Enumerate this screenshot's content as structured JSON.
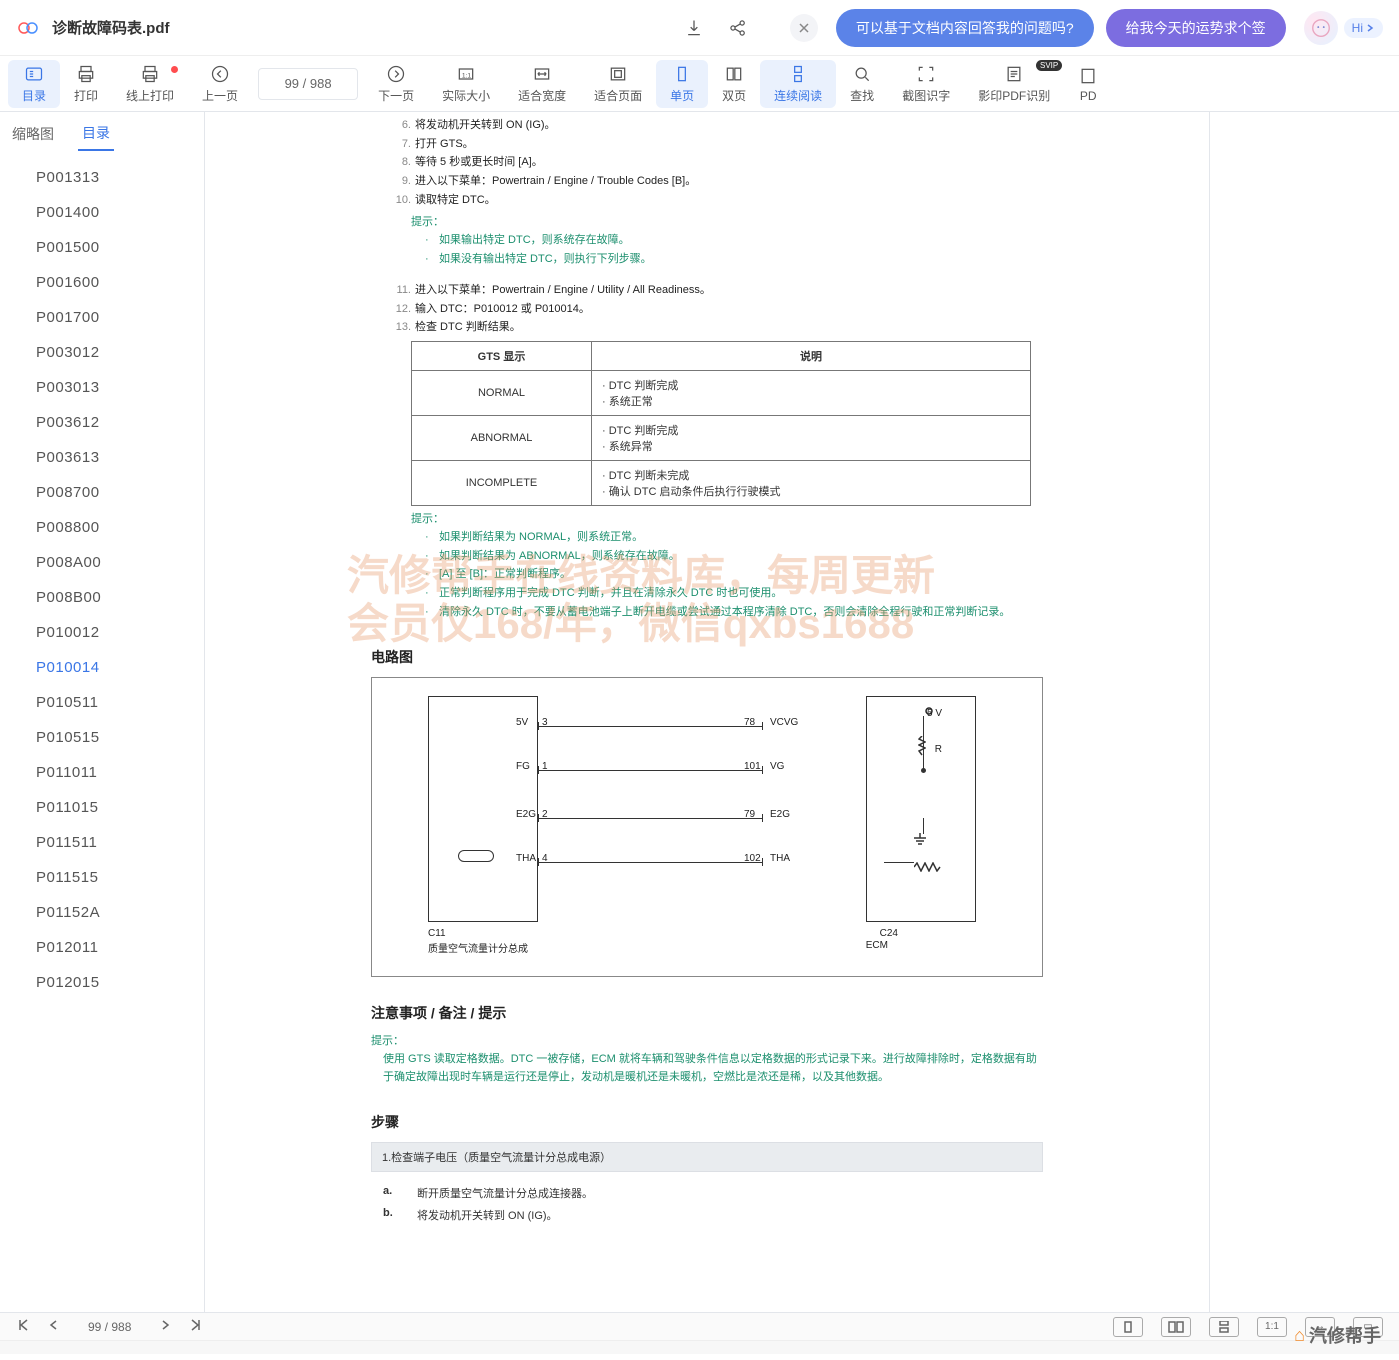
{
  "header": {
    "doc_title": "诊断故障码表.pdf",
    "chip_question": "可以基于文档内容回答我的问题吗?",
    "chip_fortune": "给我今天的运势求个签",
    "hi": "Hi",
    "download_icon": "download-icon",
    "share_icon": "share-icon",
    "close_icon": "close-icon"
  },
  "toolbar": {
    "items": [
      {
        "key": "toc",
        "label": "目录",
        "active": true
      },
      {
        "key": "print",
        "label": "打印"
      },
      {
        "key": "online_print",
        "label": "线上打印",
        "dot": true
      },
      {
        "key": "prev",
        "label": "上一页"
      },
      {
        "key": "page_ind",
        "page_text": "99 / 988",
        "is_indicator": true
      },
      {
        "key": "next",
        "label": "下一页"
      },
      {
        "key": "actual_size",
        "label": "实际大小"
      },
      {
        "key": "fit_width",
        "label": "适合宽度"
      },
      {
        "key": "fit_page",
        "label": "适合页面"
      },
      {
        "key": "single",
        "label": "单页",
        "active": true
      },
      {
        "key": "double",
        "label": "双页"
      },
      {
        "key": "continuous",
        "label": "连续阅读",
        "active": true
      },
      {
        "key": "find",
        "label": "查找"
      },
      {
        "key": "crop_ocr",
        "label": "截图识字"
      },
      {
        "key": "scan_pdf",
        "label": "影印PDF识别",
        "svip": "SVIP"
      },
      {
        "key": "pdf_trunc",
        "label": "PD"
      }
    ]
  },
  "side": {
    "tabs": [
      "缩略图",
      "目录"
    ],
    "active_tab": "目录",
    "toc": [
      "P001313",
      "P001400",
      "P001500",
      "P001600",
      "P001700",
      "P003012",
      "P003013",
      "P003612",
      "P003613",
      "P008700",
      "P008800",
      "P008A00",
      "P008B00",
      "P010012",
      "P010014",
      "P010511",
      "P010515",
      "P011011",
      "P011015",
      "P011511",
      "P011515",
      "P01152A",
      "P012011",
      "P012015"
    ],
    "active_toc": "P010014"
  },
  "doc": {
    "steps_a": [
      {
        "n": "6.",
        "t": "将发动机开关转到 ON (IG)。"
      },
      {
        "n": "7.",
        "t": "打开 GTS。"
      },
      {
        "n": "8.",
        "t": "等待 5 秒或更长时间 [A]。"
      },
      {
        "n": "9.",
        "t": "进入以下菜单：Powertrain / Engine / Trouble Codes [B]。"
      },
      {
        "n": "10.",
        "t": "读取特定 DTC。"
      }
    ],
    "hint1_title": "提示：",
    "hint1_items": [
      "如果输出特定 DTC，则系统存在故障。",
      "如果没有输出特定 DTC，则执行下列步骤。"
    ],
    "steps_b": [
      {
        "n": "11.",
        "t": "进入以下菜单：Powertrain / Engine / Utility / All Readiness。"
      },
      {
        "n": "12.",
        "t": "输入 DTC：P010012 或 P010014。"
      },
      {
        "n": "13.",
        "t": "检查 DTC 判断结果。"
      }
    ],
    "table": {
      "head": [
        "GTS 显示",
        "说明"
      ],
      "rows": [
        {
          "c1": "NORMAL",
          "c2": [
            "DTC 判断完成",
            "系统正常"
          ]
        },
        {
          "c1": "ABNORMAL",
          "c2": [
            "DTC 判断完成",
            "系统异常"
          ]
        },
        {
          "c1": "INCOMPLETE",
          "c2": [
            "DTC 判断未完成",
            "确认 DTC 启动条件后执行行驶模式"
          ]
        }
      ]
    },
    "hint2_title": "提示：",
    "hint2_items": [
      "如果判断结果为 NORMAL，则系统正常。",
      "如果判断结果为 ABNORMAL，则系统存在故障。",
      "[A] 至 [B]：正常判断程序。",
      "正常判断程序用于完成 DTC 判断，并且在清除永久 DTC 时也可使用。",
      "清除永久 DTC 时，不要从蓄电池端子上断开电缆或尝试通过本程序清除 DTC，否则会清除全程行驶和正常判断记录。"
    ],
    "circuit_title": "电路图",
    "circuit": {
      "left_label": "C11",
      "left_sub": "质量空气流量计分总成",
      "right_label": "C24",
      "right_sub": "ECM",
      "pins": [
        {
          "l": "5V",
          "ln": "3",
          "r": "VCVG",
          "rn": "78",
          "extra": "5 V"
        },
        {
          "l": "FG",
          "ln": "1",
          "r": "VG",
          "rn": "101",
          "extra": "R"
        },
        {
          "l": "E2G",
          "ln": "2",
          "r": "E2G",
          "rn": "79"
        },
        {
          "l": "THA",
          "ln": "4",
          "r": "THA",
          "rn": "102"
        }
      ]
    },
    "notes_title": "注意事项 / 备注 / 提示",
    "notes_hint_title": "提示：",
    "notes_hint_body": "使用 GTS 读取定格数据。DTC 一被存储，ECM 就将车辆和驾驶条件信息以定格数据的形式记录下来。进行故障排除时，定格数据有助于确定故障出现时车辆是运行还是停止，发动机是暖机还是未暖机，空燃比是浓还是稀，以及其他数据。",
    "steps_title": "步骤",
    "step_bar": "1.检查端子电压（质量空气流量计分总成电源）",
    "sub_steps": [
      {
        "l": "a.",
        "t": "断开质量空气流量计分总成连接器。"
      },
      {
        "l": "b.",
        "t": "将发动机开关转到 ON (IG)。"
      }
    ],
    "watermark_l1": "汽修帮手在线资料库，每周更新",
    "watermark_l2": "会员仅168/年，微信qxbs1688"
  },
  "bottombar": {
    "page": "99 / 988"
  },
  "brand": "汽修帮手"
}
